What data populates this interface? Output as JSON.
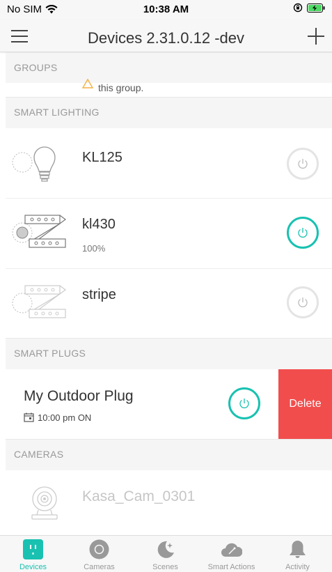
{
  "status_bar": {
    "carrier": "No SIM",
    "time": "10:38 AM"
  },
  "nav": {
    "title": "Devices 2.31.0.12 -dev"
  },
  "sections": {
    "groups": "GROUPS",
    "groups_hint": "this group.",
    "smart_lighting": "SMART LIGHTING",
    "smart_plugs": "SMART PLUGS",
    "cameras": "CAMERAS"
  },
  "devices": {
    "kl125": {
      "name": "KL125",
      "power": "off"
    },
    "kl430": {
      "name": "kl430",
      "brightness": "100%",
      "power": "on"
    },
    "stripe": {
      "name": "stripe",
      "power": "off"
    },
    "outdoor_plug": {
      "name": "My Outdoor Plug",
      "schedule": "10:00 pm ON",
      "power": "on",
      "delete_label": "Delete"
    },
    "camera": {
      "name": "Kasa_Cam_0301"
    }
  },
  "tabs": [
    {
      "label": "Devices",
      "active": true
    },
    {
      "label": "Cameras",
      "active": false
    },
    {
      "label": "Scenes",
      "active": false
    },
    {
      "label": "Smart Actions",
      "active": false
    },
    {
      "label": "Activity",
      "active": false
    }
  ],
  "colors": {
    "accent": "#19c1b1",
    "delete": "#f24d4d",
    "off_ring": "#e4e4e4",
    "warning": "#f5b041"
  }
}
